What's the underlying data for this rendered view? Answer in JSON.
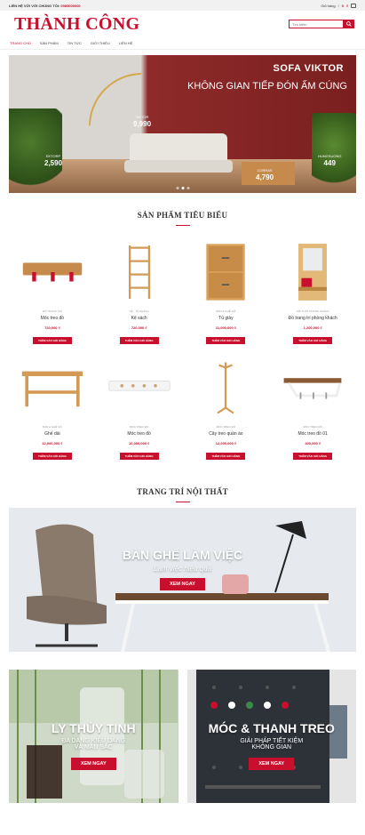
{
  "topbar": {
    "contact": "LIÊN HỆ VỚI VỚI CHÚNG TÔI:",
    "hotline": "0985000000",
    "cart_label": "Giỏ hàng",
    "cart_sep": "/",
    "cart_count": "0",
    "cart_currency": "₫"
  },
  "header": {
    "logo": "THÀNH CÔNG",
    "search_placeholder": "Tìm kiếm"
  },
  "nav": [
    "TRANG CHỦ",
    "SẢN PHẨM",
    "TIN TỨC",
    "GIỚI THIỆU",
    "LIÊN HỆ"
  ],
  "hero": {
    "title": "SOFA VIKTOR",
    "subtitle": "KHÔNG GIAN TIẾP ĐÓN ẤM CÚNG",
    "tags": [
      {
        "label": "VIKTOR",
        "price": "9,990"
      },
      {
        "label": "EKTORP",
        "price": "2,590"
      },
      {
        "label": "CORRAS",
        "price": "4,790"
      },
      {
        "label": "HUNGSUONG",
        "price": "449"
      }
    ],
    "slides": 3,
    "active_slide": 1
  },
  "featured": {
    "title": "SẢN PHẨM TIÊU BIỂU",
    "products": [
      {
        "cat": "Đồ trang trí",
        "name": "Móc treo đồ",
        "price": "720,000 ₫",
        "add": "THÊM VÀO GIỎ HÀNG",
        "kind": "hook"
      },
      {
        "cat": "Kệ - Tủ khách",
        "name": "Kệ sách",
        "price": "720,000 ₫",
        "add": "THÊM VÀO GIỎ HÀNG",
        "kind": "shelf"
      },
      {
        "cat": "Bàn & Ghế gỗ",
        "name": "Tủ giày",
        "price": "11,000,000 ₫",
        "add": "THÊM VÀO GIỎ HÀNG",
        "kind": "cabinet"
      },
      {
        "cat": "Nội thất phòng khách",
        "name": "Đồ trang trí phòng khách",
        "price": "1,200,000 ₫",
        "add": "THÊM VÀO GIỎ HÀNG",
        "kind": "hall"
      },
      {
        "cat": "Bàn & Ghế gỗ",
        "name": "Ghế dài",
        "price": "12,000,000 ₫",
        "add": "THÊM VÀO GIỎ HÀNG",
        "kind": "bench"
      },
      {
        "cat": "Móc treo đồ",
        "name": "Móc treo đồ",
        "price": "10,000,000 ₫",
        "add": "THÊM VÀO GIỎ HÀNG",
        "kind": "whitehook"
      },
      {
        "cat": "Móc treo đồ",
        "name": "Cây treo quần áo",
        "price": "12,000,000 ₫",
        "add": "THÊM VÀO GIỎ HÀNG",
        "kind": "coat"
      },
      {
        "cat": "Móc treo đồ",
        "name": "Móc treo đồ 01",
        "price": "400,000 ₫",
        "add": "THÊM VÀO GIỎ HÀNG",
        "kind": "wallshelf"
      }
    ]
  },
  "decor": {
    "title": "TRANG TRÍ NỘI THẤT",
    "main": {
      "title": "BÀN GHẾ LÀM VIỆC",
      "subtitle": "Làm việc hiệu quả",
      "button": "XEM NGAY"
    },
    "left": {
      "title": "LY THỦY TINH",
      "subtitle1": "ĐA DẠNG KIỂU DÁNG",
      "subtitle2": "VÀ MÀU SẮC",
      "button": "XEM NGAY"
    },
    "right": {
      "title": "MÓC & THANH TREO",
      "subtitle1": "GIẢI PHÁP TIẾT KIỆM",
      "subtitle2": "KHÔNG GIAN",
      "button": "XEM NGAY"
    }
  },
  "colors": {
    "accent": "#c8102e"
  }
}
